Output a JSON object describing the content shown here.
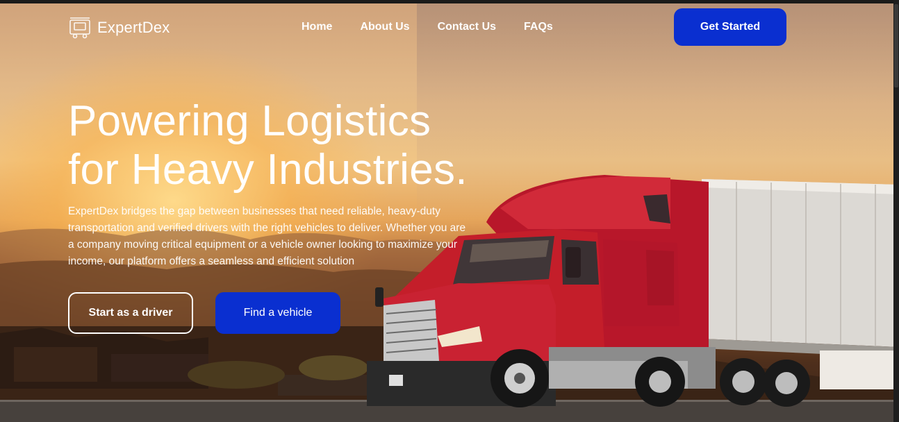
{
  "brand": {
    "name": "ExpertDex",
    "logo_icon": "truck-logo-icon"
  },
  "nav": {
    "items": [
      {
        "label": "Home"
      },
      {
        "label": "About Us"
      },
      {
        "label": "Contact Us"
      },
      {
        "label": "FAQs"
      }
    ],
    "cta_label": "Get Started"
  },
  "hero": {
    "headline_line1": "Powering Logistics",
    "headline_line2": "for Heavy Industries.",
    "description": "ExpertDex bridges the gap between businesses that need reliable, heavy-duty transportation and verified drivers with the right vehicles to deliver. Whether you are a company moving critical equipment or a vehicle owner looking to maximize your income, our platform offers a seamless and efficient solution",
    "primary_button": "Find a vehicle",
    "secondary_button": "Start as a driver"
  },
  "colors": {
    "accent": "#0a2fd0",
    "truck_red": "#c41e2a",
    "text": "#ffffff"
  }
}
